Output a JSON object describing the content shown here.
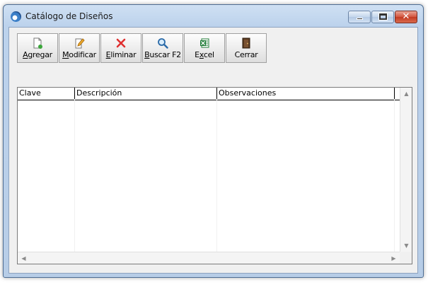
{
  "window": {
    "title": "Catálogo de Diseños",
    "controls": {
      "minimize": "minimize",
      "maximize": "maximize",
      "close": "✕"
    }
  },
  "toolbar": {
    "buttons": [
      {
        "name": "agregar",
        "mnemonic": "A",
        "rest": "gregar",
        "icon": "new-document-icon"
      },
      {
        "name": "modificar",
        "mnemonic": "M",
        "rest": "odificar",
        "icon": "edit-document-icon"
      },
      {
        "name": "eliminar",
        "mnemonic": "E",
        "rest": "liminar",
        "icon": "delete-x-icon"
      },
      {
        "name": "buscar",
        "mnemonic": "B",
        "rest": "uscar F2",
        "icon": "magnifier-icon"
      },
      {
        "name": "excel",
        "mnemonic": "x",
        "pre": "E",
        "rest": "cel",
        "icon": "excel-icon"
      },
      {
        "name": "cerrar",
        "label": "Cerrar",
        "icon": "exit-door-icon"
      }
    ]
  },
  "grid": {
    "columns": [
      "Clave",
      "Descripción",
      "Observaciones",
      ""
    ],
    "rows": []
  },
  "colors": {
    "accent": "#3b7fc8",
    "close_red": "#c23a22",
    "delete_red": "#e03030",
    "excel_green": "#1e7b36"
  }
}
